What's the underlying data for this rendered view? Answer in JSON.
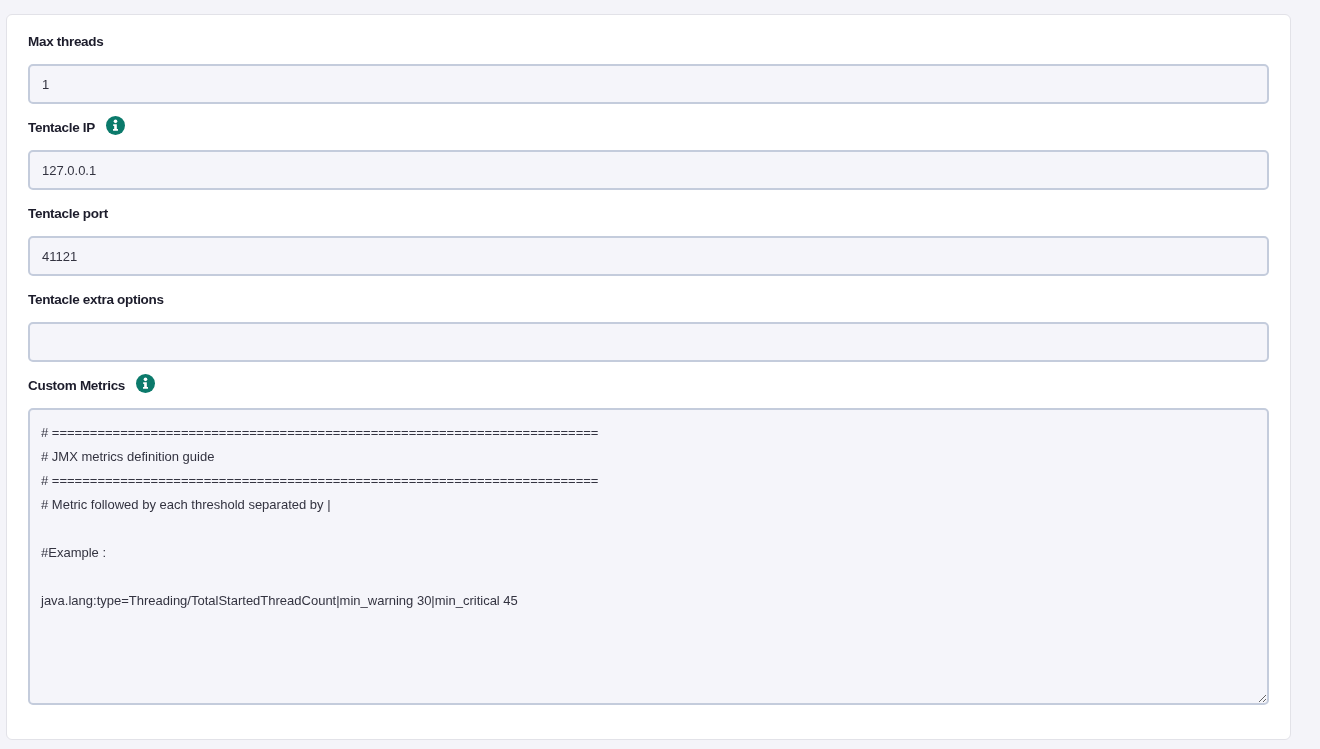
{
  "form": {
    "fields": [
      {
        "kind": "input",
        "label": "Max threads",
        "info": false,
        "value": "1"
      },
      {
        "kind": "input",
        "label": "Tentacle IP",
        "info": true,
        "value": "127.0.0.1"
      },
      {
        "kind": "input",
        "label": "Tentacle port",
        "info": false,
        "value": "41121"
      },
      {
        "kind": "input",
        "label": "Tentacle extra options",
        "info": false
      },
      {
        "kind": "textarea",
        "label": "Custom Metrics",
        "info": true,
        "value": "# ========================================================================\n# JMX metrics definition guide\n# ========================================================================\n# Metric followed by each threshold separated by |\n\n#Example :\n\njava.lang:type=Threading/TotalStartedThreadCount|min_warning 30|min_critical 45"
      }
    ]
  }
}
